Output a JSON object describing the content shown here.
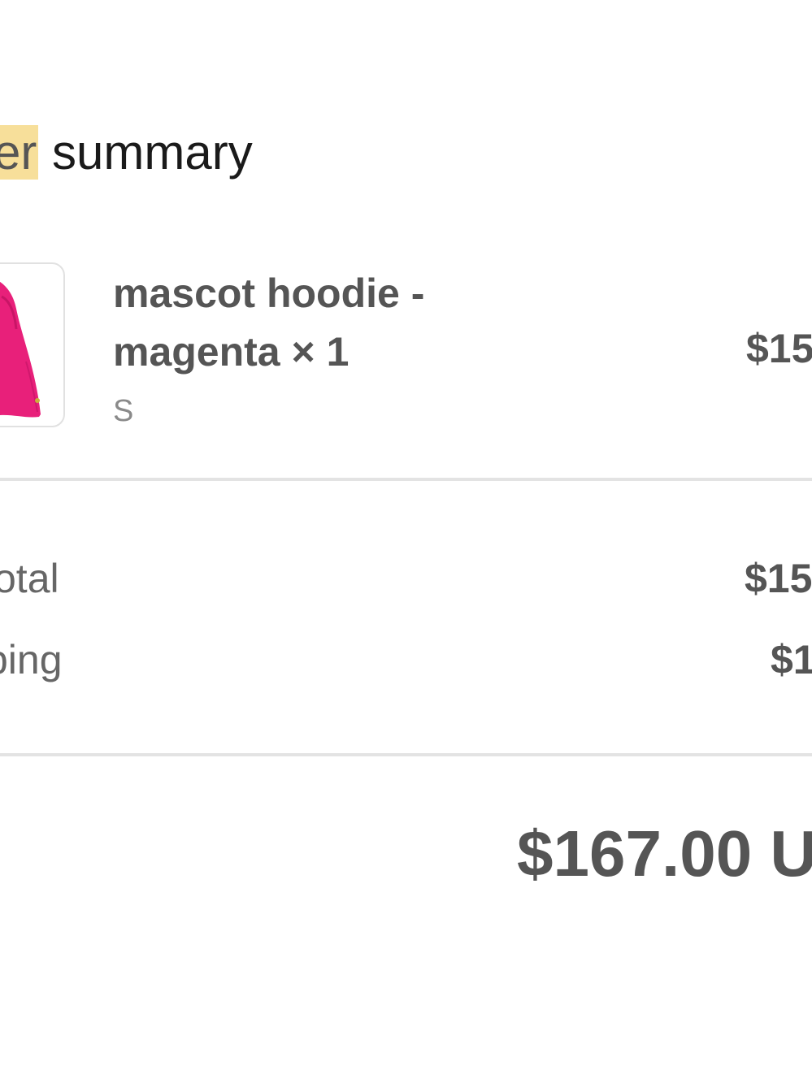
{
  "summary": {
    "title_highlight": "er",
    "title_rest": " summary"
  },
  "line_item": {
    "image_icon": "magenta-hoodie-photo",
    "name": "mascot hoodie - magenta × 1",
    "variant": "S",
    "price": "$15"
  },
  "totals": {
    "subtotal_label": "otal",
    "subtotal_value": "$15",
    "shipping_label": "ping",
    "shipping_value": "$1",
    "total_value": "$167.00 U"
  },
  "colors": {
    "highlight": "#f7df9a",
    "product": "#e8207a",
    "text_dark": "#1a1a1a",
    "text_mid": "#555555",
    "divider": "#e3e3e3"
  }
}
